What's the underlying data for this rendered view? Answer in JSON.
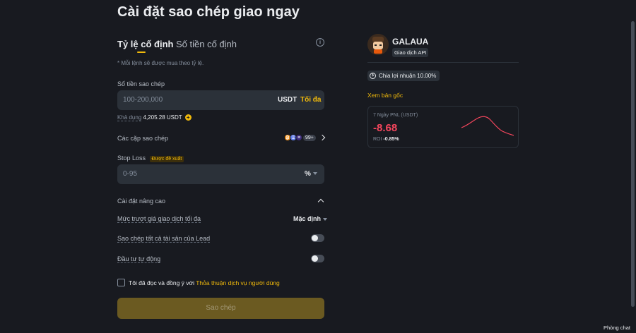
{
  "page": {
    "title": "Cài đặt sao chép giao ngay"
  },
  "tabs": [
    {
      "label": "Tỷ lệ cố định",
      "active": true
    },
    {
      "label": "Số tiền cố định",
      "active": false
    }
  ],
  "note": "* Mỗi lệnh sẽ được mua theo tỷ lệ.",
  "copy_amount": {
    "label": "Số tiền sao chép",
    "placeholder": "100-200,000",
    "unit": "USDT",
    "max_label": "Tối đa",
    "available_label": "Khả dụng",
    "available_value": "4,205.28 USDT"
  },
  "pairs": {
    "label": "Các cặp sao chép",
    "more": "99+"
  },
  "stop_loss": {
    "label": "Stop Loss",
    "badge": "Được đề xuất",
    "placeholder": "0-95",
    "unit": "%"
  },
  "advanced": {
    "title": "Cài đặt nâng cao",
    "slippage_label": "Mức trượt giá giao dịch tối đa",
    "slippage_value": "Mặc định",
    "copy_all_label": "Sao chép tất cả tài sản của Lead",
    "auto_invest_label": "Đầu tư tự động"
  },
  "agreement": {
    "text": "Tôi đã đọc và đồng ý với",
    "link": "Thỏa thuận dịch vụ người dùng"
  },
  "submit_label": "Sao chép",
  "lead": {
    "name": "GALAUA",
    "badge": "Giao dịch API",
    "profit_share": "Chia lợi nhuận 10.00%",
    "view_original": "Xem bản gốc",
    "pnl_label": "7 Ngày PNL (USDT)",
    "pnl_value": "-8.68",
    "roi_label": "ROI",
    "roi_value": "-0.85%"
  },
  "chat_label": "Phòng chat",
  "colors": {
    "accent": "#f0b90b",
    "negative": "#f6465d",
    "background": "#181a20",
    "surface": "#2b3139"
  }
}
